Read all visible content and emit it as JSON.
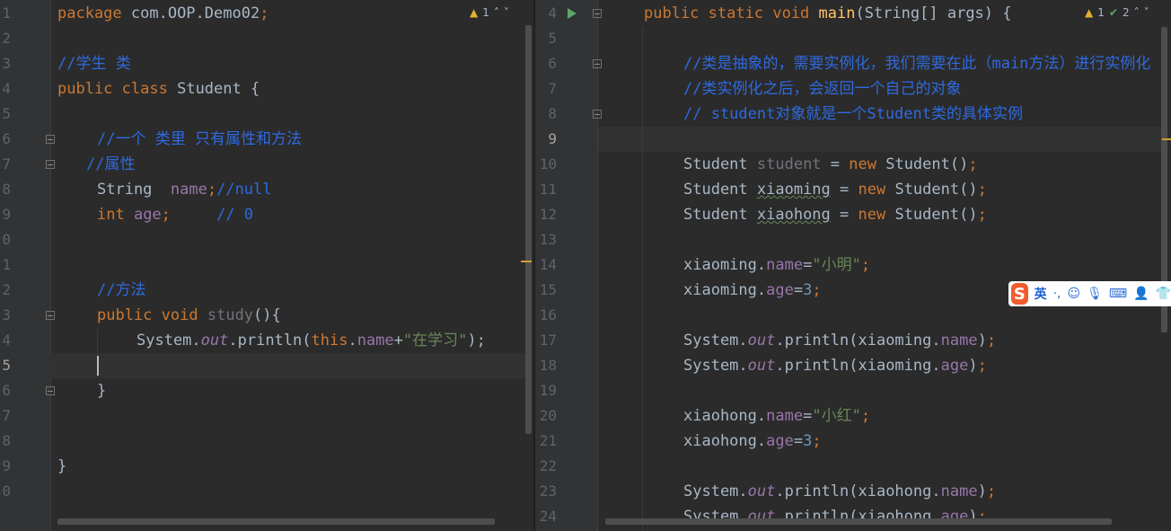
{
  "left_editor": {
    "line_numbers": [
      "1",
      "2",
      "3",
      "4",
      "5",
      "6",
      "7",
      "8",
      "9",
      "0",
      "1",
      "2",
      "3",
      "4",
      "5",
      "6",
      "7",
      "8",
      "9",
      "0"
    ],
    "status": {
      "warnings": "1"
    },
    "code": {
      "l1_kw": "package",
      "l1_rest": " com.OOP.Demo02",
      "l1_semi": ";",
      "l3_cm": "//学生 类",
      "l4_kw1": "public",
      "l4_kw2": "class",
      "l4_name": " Student {",
      "l6_cm": "//一个 类里 只有属性和方法",
      "l7_cm": "//属性",
      "l8_type": "String  ",
      "l8_fld": "name",
      "l8_semi": ";",
      "l8_cm": "//null",
      "l9_kw": "int",
      "l9_fld": " age",
      "l9_semi": ";",
      "l9_cm": "     // 0",
      "l12_cm": "//方法",
      "l13_kw1": "public",
      "l13_kw2": "void",
      "l13_fn": " study",
      "l13_rest": "(){",
      "l14_a": "System.",
      "l14_out": "out",
      "l14_b": ".println(",
      "l14_this": "this",
      "l14_dot": ".",
      "l14_fld": "name",
      "l14_plus": "+",
      "l14_str": "\"在学习\"",
      "l14_end": ");",
      "l16": "}",
      "l19": "}"
    }
  },
  "right_editor": {
    "line_numbers": [
      "4",
      "5",
      "6",
      "7",
      "8",
      "9",
      "10",
      "11",
      "12",
      "13",
      "14",
      "15",
      "16",
      "17",
      "18",
      "19",
      "20",
      "21",
      "22",
      "23",
      "24"
    ],
    "status": {
      "warnings": "1",
      "checks": "2"
    },
    "code": {
      "l4_kw1": "public",
      "l4_kw2": "static",
      "l4_kw3": "void",
      "l4_fn": "main",
      "l4_rest": "(String[] args) {",
      "l6_cm": "//类是抽象的，需要实例化，我们需要在此（main方法）进行实例化",
      "l7_cm": "//类实例化之后，会返回一个自己的对象",
      "l8_cm": "// student对象就是一个Student类的具体实例",
      "l10_a": "Student ",
      "l10_var": "student",
      "l10_b": " = ",
      "l10_new": "new",
      "l10_c": " Student()",
      "l10_semi": ";",
      "l11_a": "Student ",
      "l11_var": "xiaoming",
      "l11_b": " = ",
      "l11_new": "new",
      "l11_c": " Student()",
      "l11_semi": ";",
      "l12_a": "Student ",
      "l12_var": "xiaohong",
      "l12_b": " = ",
      "l12_new": "new",
      "l12_c": " Student()",
      "l12_semi": ";",
      "l14_a": "xiaoming.",
      "l14_fld": "name",
      "l14_eq": "=",
      "l14_str": "\"小明\"",
      "l14_semi": ";",
      "l15_a": "xiaoming.",
      "l15_fld": "age",
      "l15_eq": "=",
      "l15_num": "3",
      "l15_semi": ";",
      "l17_a": "System.",
      "l17_out": "out",
      "l17_b": ".println(xiaoming.",
      "l17_fld": "name",
      "l17_end": ")",
      "l17_semi": ";",
      "l18_a": "System.",
      "l18_out": "out",
      "l18_b": ".println(xiaoming.",
      "l18_fld": "age",
      "l18_end": ")",
      "l18_semi": ";",
      "l20_a": "xiaohong.",
      "l20_fld": "name",
      "l20_eq": "=",
      "l20_str": "\"小红\"",
      "l20_semi": ";",
      "l21_a": "xiaohong.",
      "l21_fld": "age",
      "l21_eq": "=",
      "l21_num": "3",
      "l21_semi": ";",
      "l23_a": "System.",
      "l23_out": "out",
      "l23_b": ".println(xiaohong.",
      "l23_fld": "name",
      "l23_end": ")",
      "l23_semi": ";",
      "l24_a": "System.",
      "l24_out": "out",
      "l24_b": ".println(xiaohong.",
      "l24_fld": "age",
      "l24_end": ")",
      "l24_semi": ";"
    }
  },
  "ime_toolbar": {
    "logo": "S",
    "language": "英",
    "punct": "·,",
    "icons": [
      "emoji-icon",
      "microphone-icon",
      "keyboard-icon",
      "user-icon",
      "skin-icon"
    ]
  },
  "colors": {
    "background": "#2b2b2b",
    "keyword": "#cc7832",
    "comment": "#2e6ae0",
    "string": "#6a8759",
    "field": "#9876aa",
    "text": "#a9b7c6"
  }
}
